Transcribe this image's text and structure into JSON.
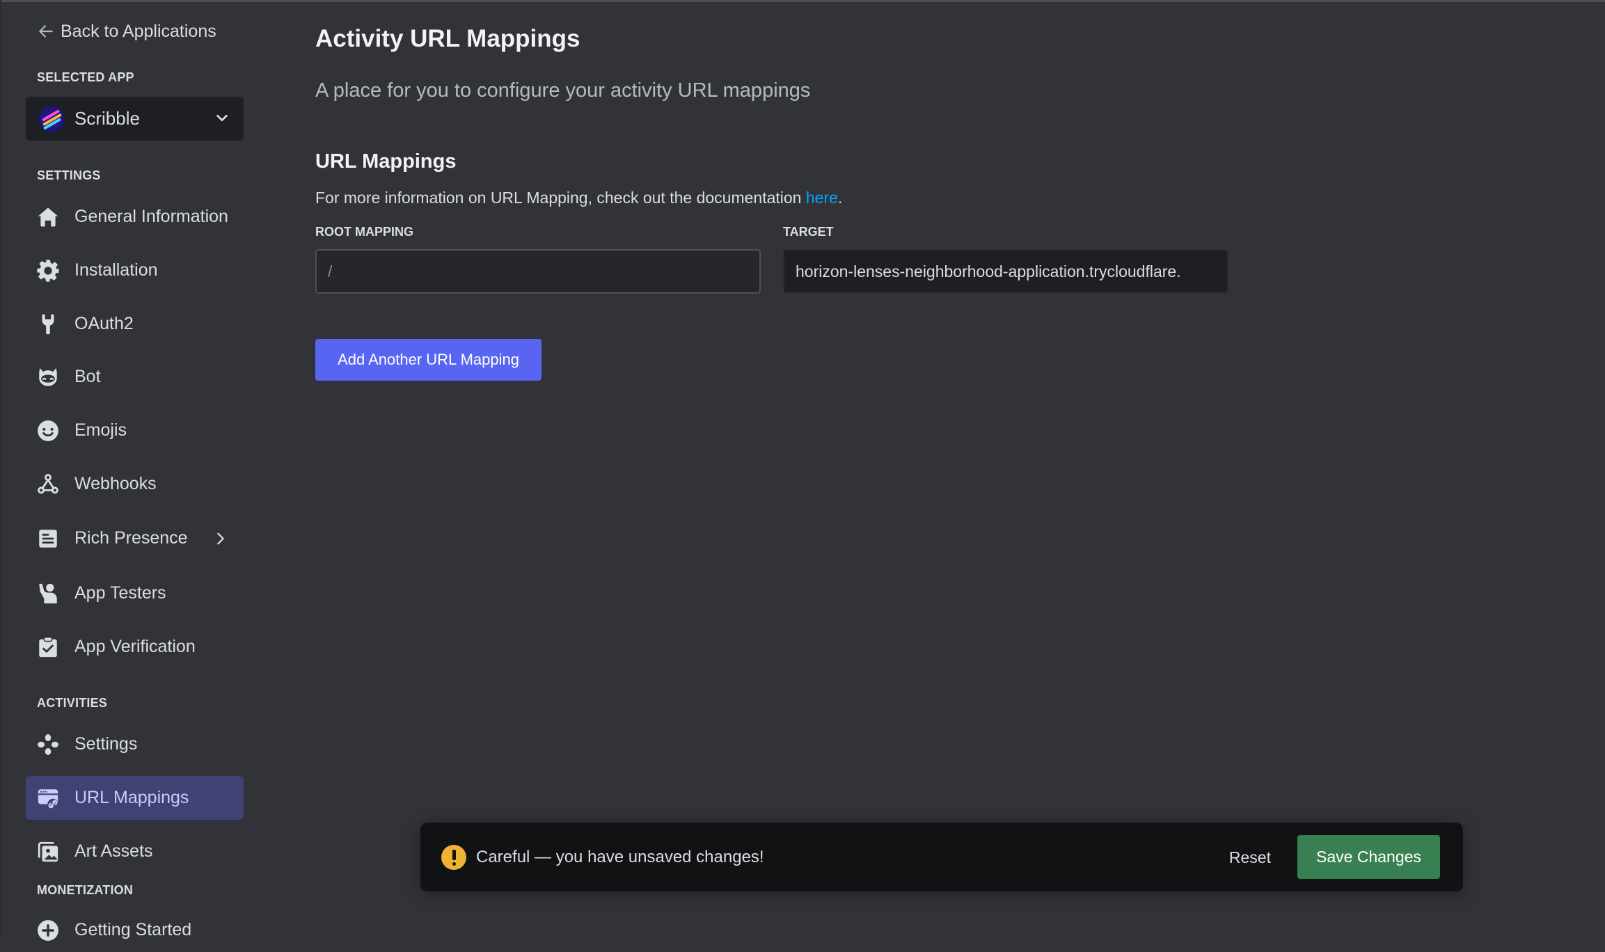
{
  "sidebar": {
    "back_label": "Back to Applications",
    "selected_app_label": "SELECTED APP",
    "selected_app": "Scribble",
    "sections": {
      "settings": "SETTINGS",
      "activities": "ACTIVITIES",
      "monetization": "MONETIZATION"
    },
    "settings_items": [
      {
        "label": "General Information",
        "icon": "home-icon"
      },
      {
        "label": "Installation",
        "icon": "gear-icon"
      },
      {
        "label": "OAuth2",
        "icon": "wrench-icon"
      },
      {
        "label": "Bot",
        "icon": "bot-icon"
      },
      {
        "label": "Emojis",
        "icon": "smiley-icon"
      },
      {
        "label": "Webhooks",
        "icon": "webhook-icon"
      },
      {
        "label": "Rich Presence",
        "icon": "document-list-icon"
      },
      {
        "label": "App Testers",
        "icon": "raised-hand-person-icon"
      },
      {
        "label": "App Verification",
        "icon": "clipboard-check-icon"
      }
    ],
    "activities_items": [
      {
        "label": "Settings",
        "icon": "gamepad-icon"
      },
      {
        "label": "URL Mappings",
        "icon": "browser-link-icon",
        "active": true
      },
      {
        "label": "Art Assets",
        "icon": "images-icon"
      }
    ],
    "monetization_items": [
      {
        "label": "Getting Started",
        "icon": "plus-circle-icon"
      }
    ]
  },
  "main": {
    "title": "Activity URL Mappings",
    "subtitle": "A place for you to configure your activity URL mappings",
    "section_title": "URL Mappings",
    "info_prefix": "For more information on URL Mapping, check out the documentation ",
    "info_link": "here",
    "info_suffix": ".",
    "root_label": "ROOT MAPPING",
    "root_placeholder": "/",
    "root_value": "",
    "target_label": "TARGET",
    "target_value": "horizon-lenses-neighborhood-application.trycloudflare.",
    "add_button": "Add Another URL Mapping"
  },
  "toast": {
    "message": "Careful — you have unsaved changes!",
    "reset": "Reset",
    "save": "Save Changes"
  },
  "colors": {
    "background": "#313338",
    "brand": "#5865f2",
    "active_nav": "#3f4273",
    "link": "#00a8fc",
    "warning": "#f0b232",
    "save": "#3e7c4c"
  }
}
